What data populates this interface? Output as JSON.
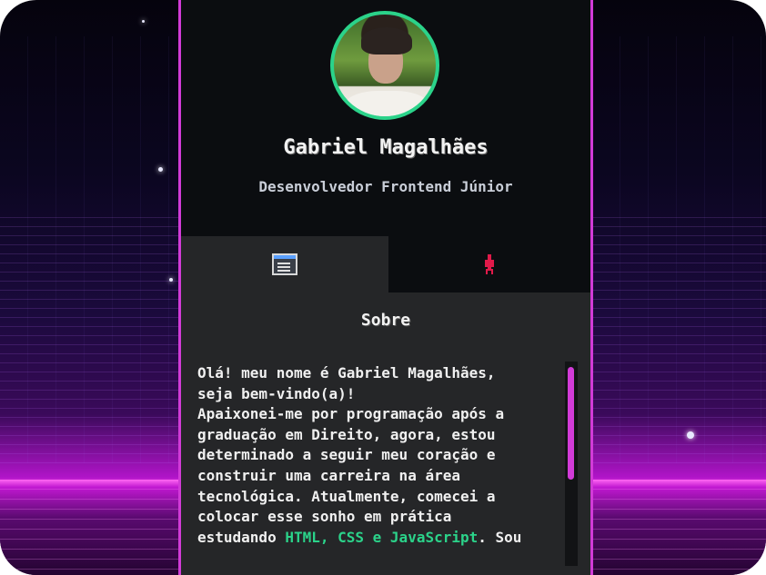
{
  "profile": {
    "name": "Gabriel Magalhães",
    "role": "Desenvolvedor Frontend Júnior"
  },
  "tabs": [
    {
      "label": "",
      "icon": "terminal-icon",
      "active": true
    },
    {
      "label": "",
      "icon": "rocket-icon",
      "active": false
    }
  ],
  "about": {
    "heading": "Sobre",
    "text_before": "Olá! meu nome é Gabriel Magalhães,\nseja bem-vindo(a)!\nApaixonei-me por programação após a\ngraduação em Direito, agora, estou\ndeterminado a seguir meu coração e\nconstruir uma carreira na área\ntecnológica. Atualmente, comecei a\ncolocar esse sonho em prática\nestudando ",
    "highlight": "HTML, CSS e JavaScript",
    "text_after": ". Sou"
  },
  "colors": {
    "accent": "#d23bd8",
    "avatar_ring": "#2bd38a",
    "highlight": "#2bd38a",
    "card_bg": "#0b0d10",
    "panel_bg": "#252628"
  }
}
